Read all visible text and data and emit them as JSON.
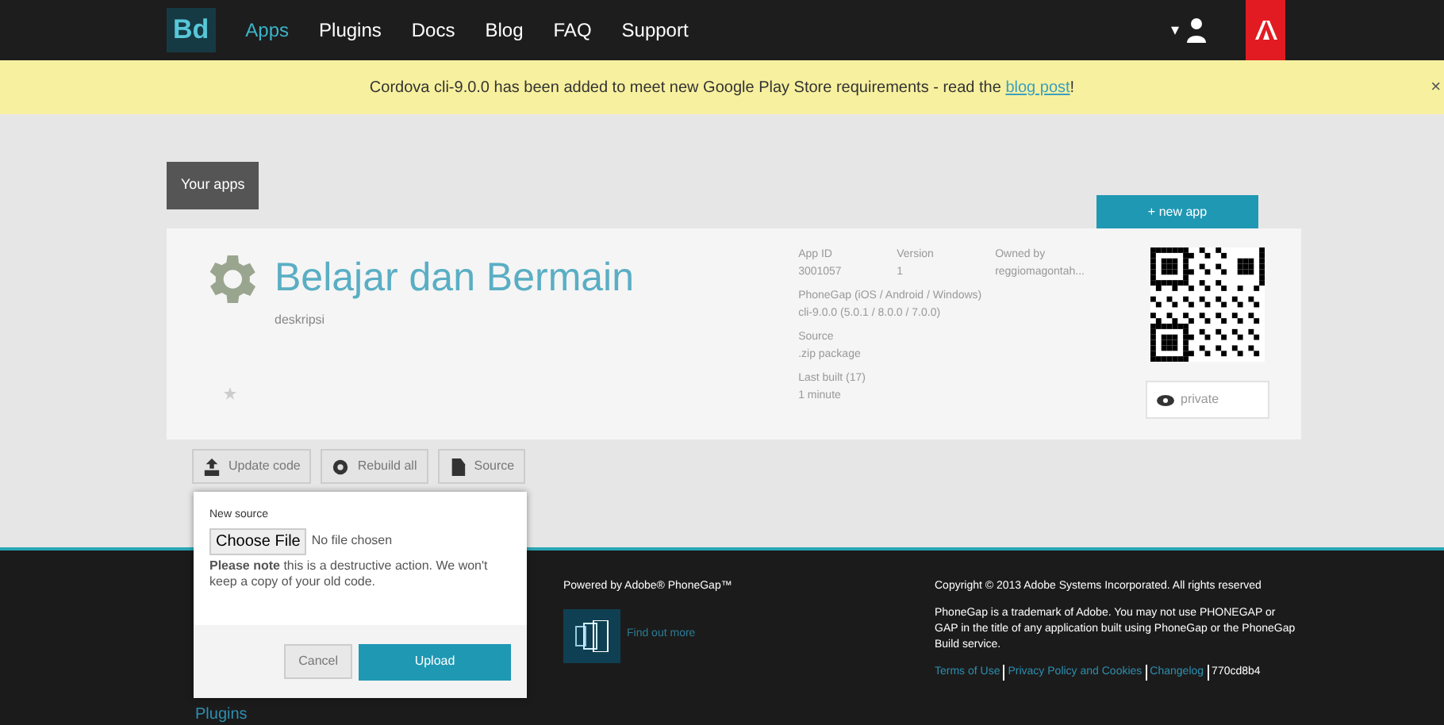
{
  "nav": {
    "logo": "Bd",
    "items": [
      {
        "label": "Apps",
        "selected": true
      },
      {
        "label": "Plugins",
        "selected": false
      },
      {
        "label": "Docs",
        "selected": false
      },
      {
        "label": "Blog",
        "selected": false
      },
      {
        "label": "FAQ",
        "selected": false
      },
      {
        "label": "Support",
        "selected": false
      }
    ],
    "user_caret": "▾"
  },
  "banner": {
    "text": "Cordova cli-9.0.0 has been added to meet new Google Play Store requirements - read the ",
    "link": "blog post",
    "after": "!",
    "close": "×"
  },
  "your_apps_tab": "Your apps",
  "new_app_button": "+ new app",
  "app": {
    "name": "Belajar dan Bermain",
    "description": "deskripsi",
    "meta": [
      {
        "label": "App ID",
        "value": "3001057"
      },
      {
        "label": "Version",
        "value": "1"
      },
      {
        "label": "Owned by",
        "value": "reggiomagontah..."
      }
    ],
    "details": [
      {
        "label": "PhoneGap (iOS / Android / Windows)",
        "value": "cli-9.0.0 (5.0.1 / 8.0.0 / 7.0.0)"
      },
      {
        "label": "Source",
        "value": ".zip package"
      },
      {
        "label": "Last built (17)",
        "value": "1 minute"
      }
    ],
    "privacy": "private"
  },
  "actions": [
    "Update code",
    "Rebuild all",
    "Source"
  ],
  "popup": {
    "label": "New source",
    "file_button": "Choose File",
    "file_status": "No file chosen",
    "note": "**Please note** this is a destructive action. We won't keep a copy of your old code.",
    "cancel": "Cancel",
    "upload": "Upload"
  },
  "footer": {
    "powered": "Powered by Adobe® PhoneGap™",
    "find_out": "Find out more",
    "copyright": "Copyright © 2013 Adobe Systems Incorporated. All rights reserved",
    "trademark": "PhoneGap is a trademark of Adobe. You may not use PHONEGAP or GAP in the title of any application built using PhoneGap or the PhoneGap Build service.",
    "links": [
      "Terms of Use",
      "Privacy Policy and Cookies",
      "Changelog"
    ],
    "build": "770cd8b4",
    "section": "Plugins"
  }
}
